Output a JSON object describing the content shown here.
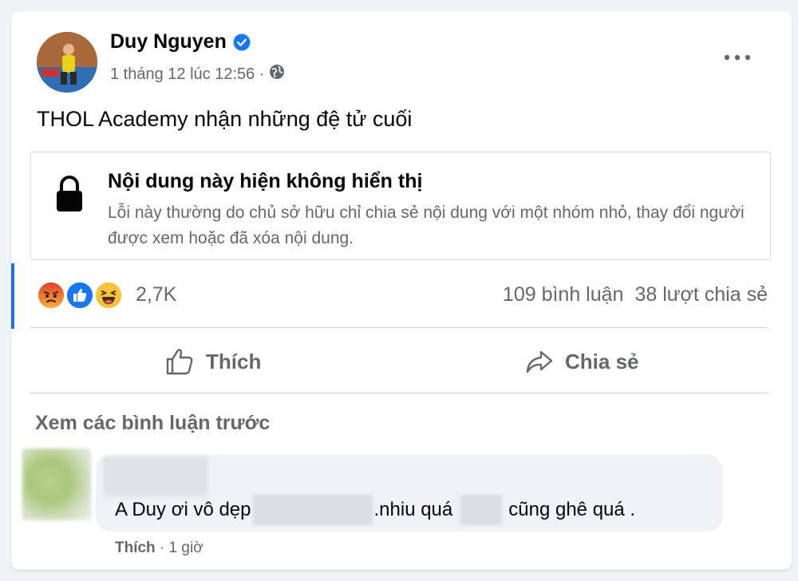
{
  "post": {
    "author": "Duy Nguyen",
    "timestamp": "1 tháng 12 lúc 12:56 ·",
    "privacy_icon": "globe-icon",
    "text": "THOL Academy nhận những đệ tử cuối"
  },
  "unavailable": {
    "title": "Nội dung này hiện không hiển thị",
    "description": "Lỗi này thường do chủ sở hữu chỉ chia sẻ nội dung với một nhóm nhỏ, thay đổi người được xem hoặc đã xóa nội dung."
  },
  "reactions": {
    "types": [
      "angry",
      "like",
      "haha"
    ],
    "count": "2,7K",
    "comments": "109 bình luận",
    "shares": "38 lượt chia sẻ"
  },
  "actions": {
    "like_label": "Thích",
    "share_label": "Chia sẻ"
  },
  "comments": {
    "view_previous": "Xem các bình luận trước",
    "items": [
      {
        "text_part1": "A Duy ơi vô dẹp",
        "text_part2": ".nhiu quá",
        "text_part3": "cũng ghê quá .",
        "like_label": "Thích",
        "time": "· 1 giờ"
      }
    ]
  },
  "colors": {
    "background": "#f0f2f5",
    "card": "#ffffff",
    "secondary_text": "#65676b",
    "accent": "#1b74e4",
    "verified": "#1877f2"
  }
}
